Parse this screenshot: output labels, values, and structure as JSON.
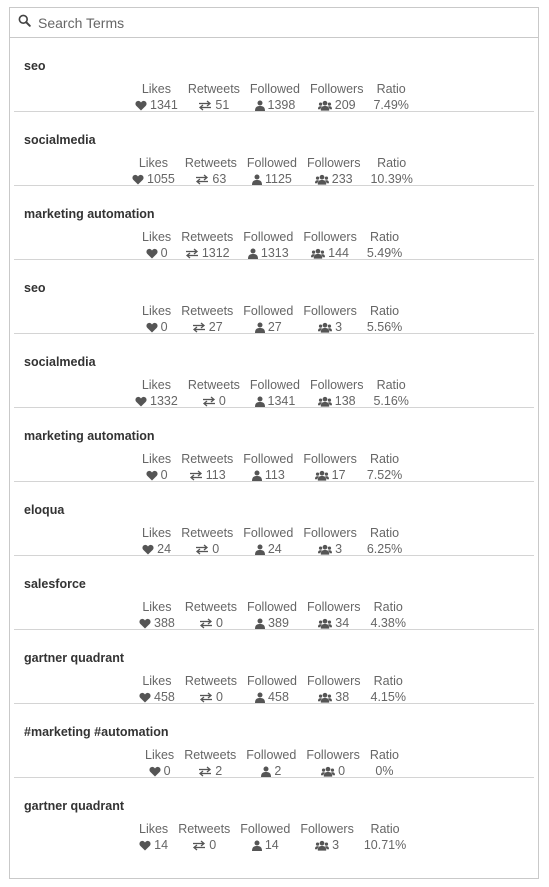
{
  "search": {
    "placeholder": "Search Terms",
    "value": ""
  },
  "columns": {
    "likes": "Likes",
    "retweets": "Retweets",
    "followed": "Followed",
    "followers": "Followers",
    "ratio": "Ratio"
  },
  "terms": [
    {
      "name": "seo",
      "likes": "1341",
      "retweets": "51",
      "followed": "1398",
      "followers": "209",
      "ratio": "7.49%"
    },
    {
      "name": "socialmedia",
      "likes": "1055",
      "retweets": "63",
      "followed": "1125",
      "followers": "233",
      "ratio": "10.39%"
    },
    {
      "name": "marketing automation",
      "likes": "0",
      "retweets": "1312",
      "followed": "1313",
      "followers": "144",
      "ratio": "5.49%"
    },
    {
      "name": "seo",
      "likes": "0",
      "retweets": "27",
      "followed": "27",
      "followers": "3",
      "ratio": "5.56%"
    },
    {
      "name": "socialmedia",
      "likes": "1332",
      "retweets": "0",
      "followed": "1341",
      "followers": "138",
      "ratio": "5.16%"
    },
    {
      "name": "marketing automation",
      "likes": "0",
      "retweets": "113",
      "followed": "113",
      "followers": "17",
      "ratio": "7.52%"
    },
    {
      "name": "eloqua",
      "likes": "24",
      "retweets": "0",
      "followed": "24",
      "followers": "3",
      "ratio": "6.25%"
    },
    {
      "name": "salesforce",
      "likes": "388",
      "retweets": "0",
      "followed": "389",
      "followers": "34",
      "ratio": "4.38%"
    },
    {
      "name": "gartner quadrant",
      "likes": "458",
      "retweets": "0",
      "followed": "458",
      "followers": "38",
      "ratio": "4.15%"
    },
    {
      "name": "#marketing #automation",
      "likes": "0",
      "retweets": "2",
      "followed": "2",
      "followers": "0",
      "ratio": "0%"
    },
    {
      "name": "gartner quadrant",
      "likes": "14",
      "retweets": "0",
      "followed": "14",
      "followers": "3",
      "ratio": "10.71%"
    }
  ],
  "icons": {
    "search": "search-icon",
    "likes": "heart-icon",
    "retweets": "retweet-icon",
    "followed": "user-icon",
    "followers": "users-icon"
  },
  "colors": {
    "text": "#555555",
    "icon": "#555555",
    "border": "#c9c9c9",
    "divider": "#d4d4d4"
  }
}
